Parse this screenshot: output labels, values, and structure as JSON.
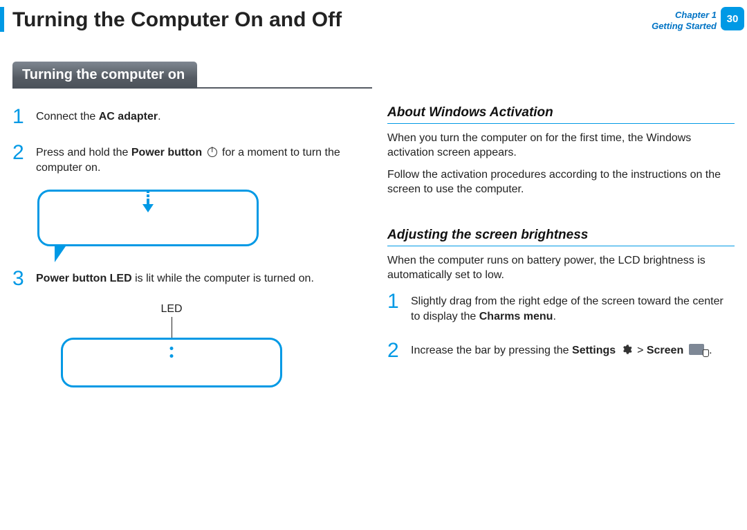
{
  "header": {
    "title": "Turning the Computer On and Off",
    "chapter_line1": "Chapter 1",
    "chapter_line2": "Getting Started",
    "page_number": "30"
  },
  "section": {
    "title": "Turning the computer on"
  },
  "left": {
    "step1": {
      "num": "1",
      "pre": "Connect the ",
      "bold": "AC adapter",
      "post": "."
    },
    "step2": {
      "num": "2",
      "pre": "Press and hold the ",
      "bold": "Power button",
      "post": " for a moment to turn the computer on."
    },
    "step3": {
      "num": "3",
      "bold": "Power button LED",
      "post": " is lit while the computer is turned on."
    },
    "led_label": "LED"
  },
  "right": {
    "activation": {
      "heading": "About Windows Activation",
      "p1": "When you turn the computer on for the ﬁrst time, the Windows activation screen appears.",
      "p2": "Follow the activation procedures according to the instructions on the screen to use the computer."
    },
    "brightness": {
      "heading": "Adjusting the screen brightness",
      "p1": "When the computer runs on battery power, the LCD brightness is automatically set to low.",
      "step1": {
        "num": "1",
        "pre": "Slightly drag from the right edge of the screen toward the center to display the ",
        "bold": "Charms menu",
        "post": "."
      },
      "step2": {
        "num": "2",
        "pre": "Increase the bar by pressing the ",
        "bold1": "Settings",
        "sep": " > ",
        "bold2": "Screen",
        "post": " ."
      }
    }
  }
}
